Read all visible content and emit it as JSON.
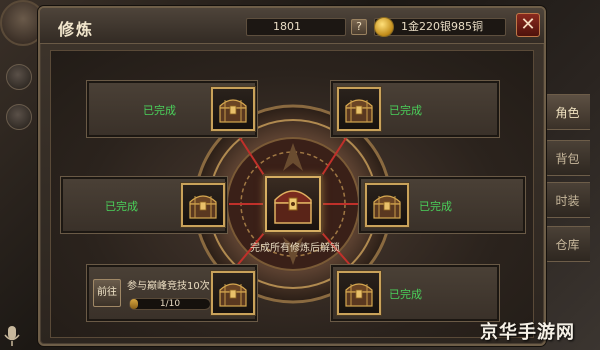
{
  "window": {
    "title": "修炼"
  },
  "currency": {
    "diamonds": "1801",
    "help_label": "?",
    "gold": "1金220银985铜",
    "close_label": "✕"
  },
  "tasks": {
    "top_left": {
      "status": "已完成"
    },
    "top_right": {
      "status": "已完成"
    },
    "mid_left": {
      "status": "已完成"
    },
    "mid_right": {
      "status": "已完成"
    },
    "bottom_right": {
      "status": "已完成"
    },
    "bottom_left": {
      "goto_label": "前往",
      "description": "参与巅峰竞技10次",
      "progress_text": "1/10",
      "progress_value": 0.1
    }
  },
  "center": {
    "caption": "完成所有修炼后解锁"
  },
  "side_tabs": [
    "角色",
    "背包",
    "时装",
    "仓库"
  ],
  "watermark": "京华手游网",
  "colors": {
    "completed": "#4ad05a",
    "slot_border": "#c9a25a"
  }
}
